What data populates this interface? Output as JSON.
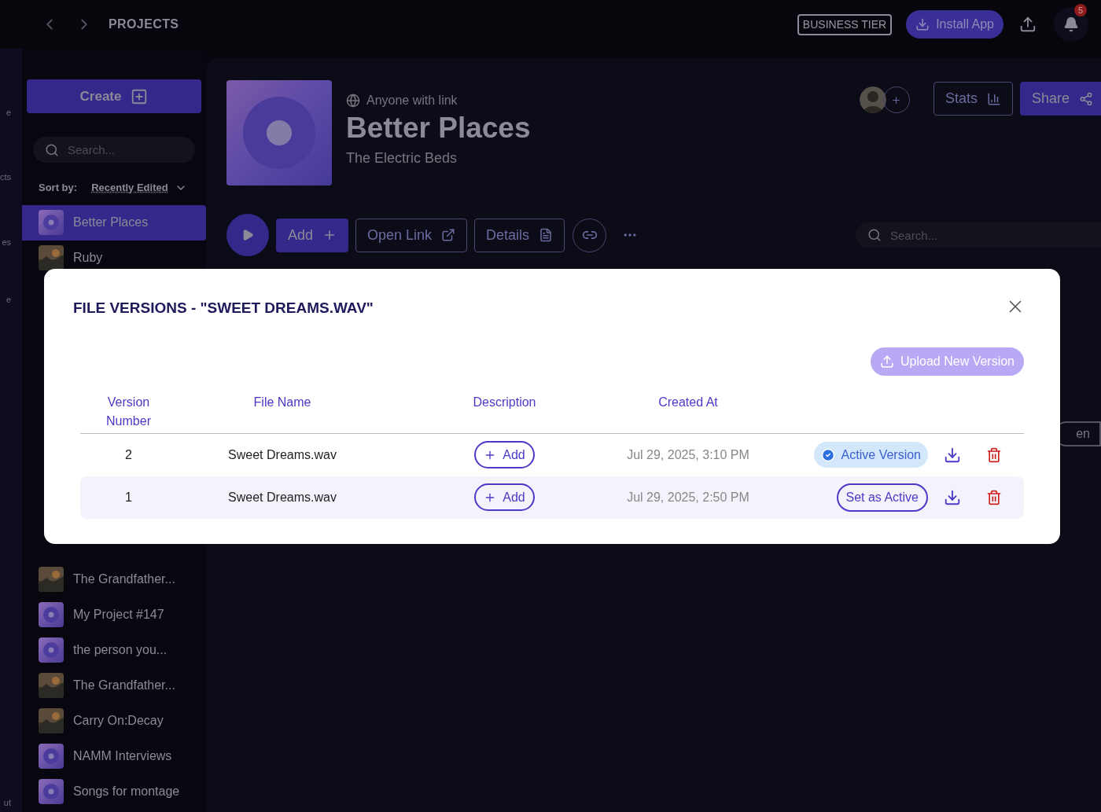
{
  "topbar": {
    "title": "PROJECTS",
    "tier_badge": "BUSINESS TIER",
    "install_button": "Install App",
    "notification_count": "5"
  },
  "rail": {
    "labels": [
      "e",
      "cts",
      "es",
      "e",
      "ut"
    ]
  },
  "sidebar": {
    "create_button": "Create",
    "search": {
      "placeholder": "Search..."
    },
    "sort_label": "Sort by:",
    "sort_value": "Recently Edited",
    "items": [
      {
        "name": "Better Places",
        "kind": "disc",
        "selected": true
      },
      {
        "name": "Ruby",
        "selected": false
      }
    ],
    "lower_items": [
      {
        "name": "The Grandfather...",
        "selected": false
      },
      {
        "name": "My Project #147",
        "kind": "disc",
        "selected": false
      },
      {
        "name": "the person you...",
        "kind": "disc",
        "selected": false
      },
      {
        "name": "The Grandfather...",
        "selected": false
      },
      {
        "name": "Carry On:Decay",
        "selected": false
      },
      {
        "name": "NAMM Interviews",
        "kind": "disc",
        "selected": false
      },
      {
        "name": "Songs for montage",
        "kind": "disc",
        "selected": false
      }
    ]
  },
  "project": {
    "visibility": "Anyone with link",
    "title": "Better Places",
    "artist": "The Electric Beds",
    "stats_button": "Stats",
    "share_button": "Share",
    "add_button": "Add",
    "open_link_button": "Open Link",
    "details_button": "Details",
    "search": {
      "placeholder": "Search..."
    },
    "partial_button": "en"
  },
  "modal": {
    "title": "FILE VERSIONS - \"SWEET DREAMS.WAV\"",
    "upload_button": "Upload New Version",
    "columns": [
      "Version Number",
      "File Name",
      "Description",
      "Created At"
    ],
    "rows": [
      {
        "version": "2",
        "file_name": "Sweet Dreams.wav",
        "description_button": "Add",
        "created_at": "Jul 29, 2025, 3:10 PM",
        "active": true,
        "status": "Active Version"
      },
      {
        "version": "1",
        "file_name": "Sweet Dreams.wav",
        "description_button": "Add",
        "created_at": "Jul 29, 2025, 2:50 PM",
        "active": false,
        "status": "Set as Active"
      }
    ]
  }
}
